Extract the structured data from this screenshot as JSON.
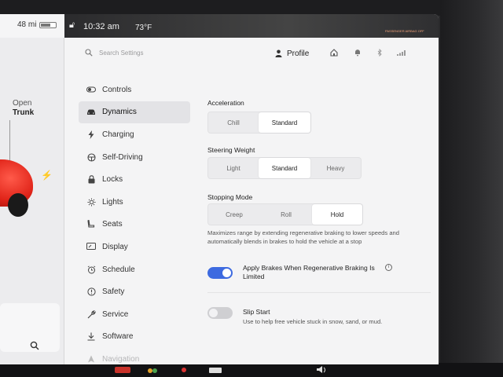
{
  "status": {
    "range": "48 mi",
    "time": "10:32 am",
    "temperature": "73°F",
    "passenger_airbag": "PASSENGER AIRBAG OFF"
  },
  "car_panel": {
    "trunk_action": "Open",
    "trunk_label": "Trunk"
  },
  "header": {
    "search_placeholder": "Search Settings",
    "profile_label": "Profile"
  },
  "nav": {
    "items": [
      {
        "label": "Controls",
        "icon": "toggle-icon",
        "active": false
      },
      {
        "label": "Dynamics",
        "icon": "car-icon",
        "active": true
      },
      {
        "label": "Charging",
        "icon": "bolt-icon",
        "active": false
      },
      {
        "label": "Self-Driving",
        "icon": "steering-wheel-icon",
        "active": false
      },
      {
        "label": "Locks",
        "icon": "lock-icon",
        "active": false
      },
      {
        "label": "Lights",
        "icon": "sun-icon",
        "active": false
      },
      {
        "label": "Seats",
        "icon": "seat-icon",
        "active": false
      },
      {
        "label": "Display",
        "icon": "display-icon",
        "active": false
      },
      {
        "label": "Schedule",
        "icon": "alarm-clock-icon",
        "active": false
      },
      {
        "label": "Safety",
        "icon": "alert-circle-icon",
        "active": false
      },
      {
        "label": "Service",
        "icon": "wrench-icon",
        "active": false
      },
      {
        "label": "Software",
        "icon": "download-icon",
        "active": false
      },
      {
        "label": "Navigation",
        "icon": "navigation-arrow-icon",
        "active": false
      }
    ]
  },
  "dynamics": {
    "acceleration": {
      "label": "Acceleration",
      "options": [
        "Chill",
        "Standard"
      ],
      "selected": "Standard"
    },
    "steering_weight": {
      "label": "Steering Weight",
      "options": [
        "Light",
        "Standard",
        "Heavy"
      ],
      "selected": "Standard"
    },
    "stopping_mode": {
      "label": "Stopping Mode",
      "options": [
        "Creep",
        "Roll",
        "Hold"
      ],
      "selected": "Hold",
      "description": "Maximizes range by extending regenerative braking to lower speeds and automatically blends in brakes to hold the vehicle at a stop"
    },
    "apply_brakes": {
      "label": "Apply Brakes When Regenerative Braking Is Limited",
      "enabled": true
    },
    "slip_start": {
      "label": "Slip Start",
      "description": "Use to help free vehicle stuck in snow, sand, or mud.",
      "enabled": false
    }
  },
  "colors": {
    "accent": "#3d6ae0",
    "car": "#e02419"
  }
}
